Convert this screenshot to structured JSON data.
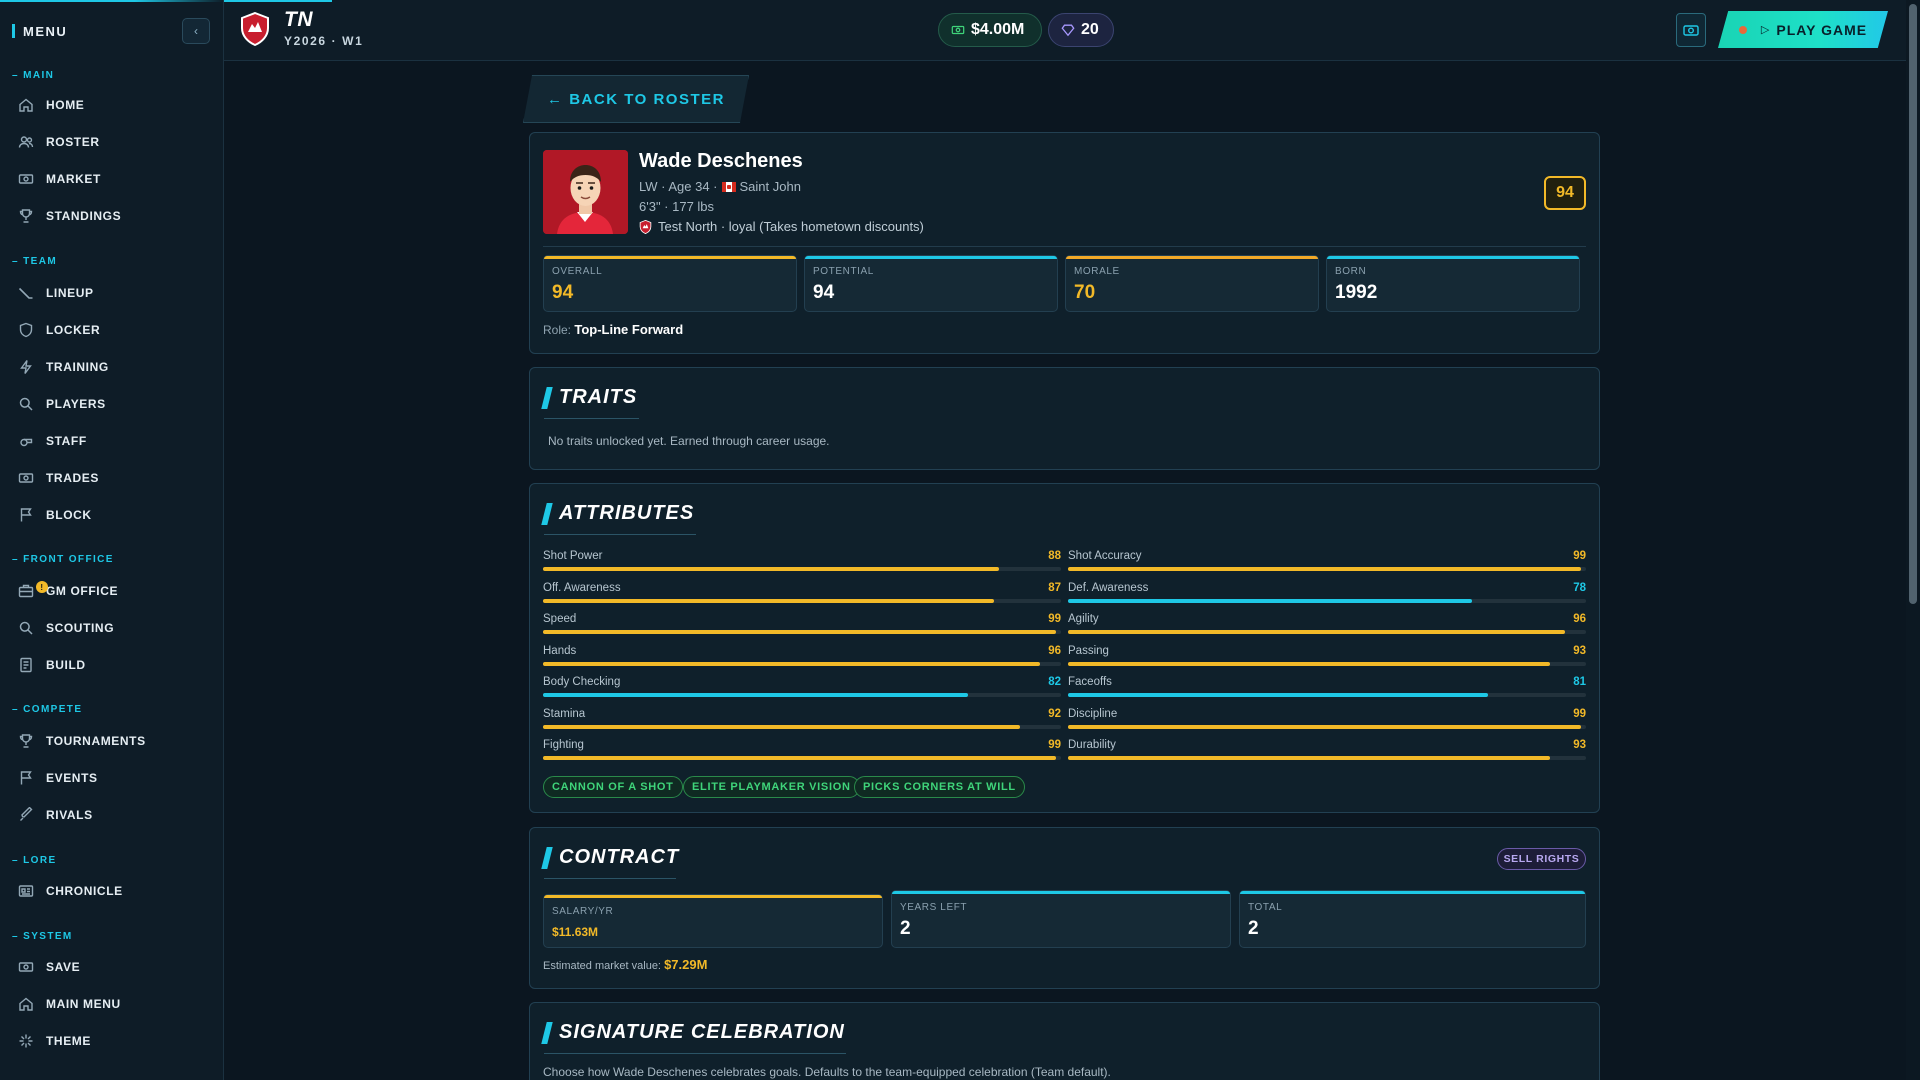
{
  "sidebar": {
    "menu_label": "MENU",
    "collapse_icon": "chevron-left-icon",
    "sections": [
      {
        "label": "MAIN",
        "items": [
          {
            "label": "HOME",
            "icon": "home-icon"
          },
          {
            "label": "ROSTER",
            "icon": "users-icon"
          },
          {
            "label": "MARKET",
            "icon": "cash-icon"
          },
          {
            "label": "STANDINGS",
            "icon": "trophy-icon"
          }
        ]
      },
      {
        "label": "TEAM",
        "items": [
          {
            "label": "LINEUP",
            "icon": "hockey-stick-icon"
          },
          {
            "label": "LOCKER",
            "icon": "shield-icon"
          },
          {
            "label": "TRAINING",
            "icon": "bolt-icon"
          },
          {
            "label": "PLAYERS",
            "icon": "search-icon"
          },
          {
            "label": "STAFF",
            "icon": "whistle-icon"
          },
          {
            "label": "TRADES",
            "icon": "cash-icon"
          },
          {
            "label": "BLOCK",
            "icon": "flag-icon"
          }
        ]
      },
      {
        "label": "FRONT OFFICE",
        "items": [
          {
            "label": "GM OFFICE",
            "icon": "briefcase-icon",
            "badge": "!"
          },
          {
            "label": "SCOUTING",
            "icon": "search-icon"
          },
          {
            "label": "BUILD",
            "icon": "clipboard-icon"
          }
        ]
      },
      {
        "label": "COMPETE",
        "items": [
          {
            "label": "TOURNAMENTS",
            "icon": "trophy-icon"
          },
          {
            "label": "EVENTS",
            "icon": "flag-icon"
          },
          {
            "label": "RIVALS",
            "icon": "sword-icon"
          }
        ]
      },
      {
        "label": "LORE",
        "items": [
          {
            "label": "CHRONICLE",
            "icon": "newspaper-icon"
          }
        ]
      },
      {
        "label": "SYSTEM",
        "items": [
          {
            "label": "SAVE",
            "icon": "save-icon"
          },
          {
            "label": "MAIN MENU",
            "icon": "home-icon"
          },
          {
            "label": "THEME",
            "icon": "sparkle-icon"
          }
        ]
      }
    ]
  },
  "topbar": {
    "team_abbr": "TN",
    "season": "Y2026 · W1",
    "money": "$4.00M",
    "gems": "20",
    "play_label": "PLAY GAME",
    "accent": "#1ec8e6"
  },
  "back_label": "← BACK TO ROSTER",
  "player": {
    "name": "Wade Deschenes",
    "position_age": "LW · Age 34 ·",
    "hometown": "Saint John",
    "body": "6'3\" · 177 lbs",
    "team_line": "Test North · loyal (Takes hometown discounts)",
    "overall_badge": "94",
    "stats": [
      {
        "label": "OVERALL",
        "value": "94",
        "color": "#f2b928"
      },
      {
        "label": "POTENTIAL",
        "value": "94",
        "color": "#ffffff"
      },
      {
        "label": "MORALE",
        "value": "70",
        "color": "#f2b928"
      },
      {
        "label": "BORN",
        "value": "1992",
        "color": "#ffffff"
      }
    ],
    "role_label": "Role:",
    "role": "Top-Line Forward"
  },
  "traits": {
    "title": "TRAITS",
    "empty_text": "No traits unlocked yet. Earned through career usage."
  },
  "attributes": {
    "title": "ATTRIBUTES",
    "left": [
      {
        "name": "Shot Power",
        "value": 88
      },
      {
        "name": "Off. Awareness",
        "value": 87
      },
      {
        "name": "Speed",
        "value": 99
      },
      {
        "name": "Hands",
        "value": 96
      },
      {
        "name": "Body Checking",
        "value": 82
      },
      {
        "name": "Stamina",
        "value": 92
      },
      {
        "name": "Fighting",
        "value": 99
      }
    ],
    "right": [
      {
        "name": "Shot Accuracy",
        "value": 99
      },
      {
        "name": "Def. Awareness",
        "value": 78
      },
      {
        "name": "Agility",
        "value": 96
      },
      {
        "name": "Passing",
        "value": 93
      },
      {
        "name": "Faceoffs",
        "value": 81
      },
      {
        "name": "Discipline",
        "value": 99
      },
      {
        "name": "Durability",
        "value": 93
      }
    ],
    "tags": [
      "CANNON OF A SHOT",
      "ELITE PLAYMAKER VISION",
      "PICKS CORNERS AT WILL"
    ],
    "high_color": "#f2b928",
    "mid_color": "#1ec8e6"
  },
  "contract": {
    "title": "CONTRACT",
    "sell_label": "SELL RIGHTS",
    "boxes": [
      {
        "label": "SALARY/YR",
        "value": "$11.63M"
      },
      {
        "label": "YEARS LEFT",
        "value": "2"
      },
      {
        "label": "TOTAL",
        "value": "2"
      }
    ],
    "est_label": "Estimated market value:",
    "est_value": "$7.29M"
  },
  "celebration": {
    "title": "SIGNATURE CELEBRATION",
    "text": "Choose how Wade Deschenes celebrates goals. Defaults to the team-equipped celebration (Team default)."
  }
}
